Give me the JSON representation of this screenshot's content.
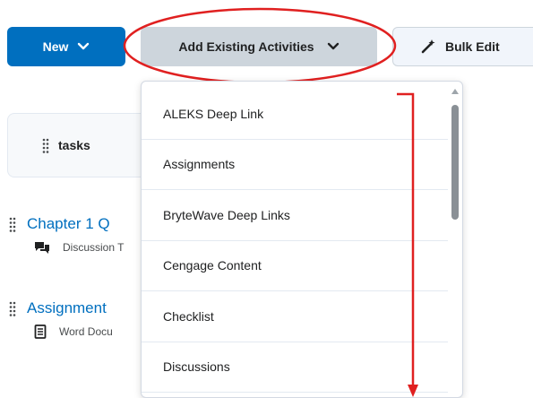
{
  "toolbar": {
    "new_label": "New",
    "add_existing_label": "Add Existing Activities",
    "bulk_edit_label": "Bulk Edit"
  },
  "tasks_card": {
    "label": "tasks"
  },
  "content_rows": [
    {
      "title": "Chapter 1 Q",
      "subtitle": "Discussion T",
      "icon": "discussion-icon"
    },
    {
      "title": "Assignment",
      "subtitle": "Word Docu",
      "icon": "document-icon"
    }
  ],
  "dropdown": {
    "items": [
      "ALEKS Deep Link",
      "Assignments",
      "BryteWave Deep Links",
      "Cengage Content",
      "Checklist",
      "Discussions"
    ]
  },
  "colors": {
    "primary": "#006fbf",
    "annotation": "#e02020",
    "secondary_button": "#cdd5dc"
  }
}
